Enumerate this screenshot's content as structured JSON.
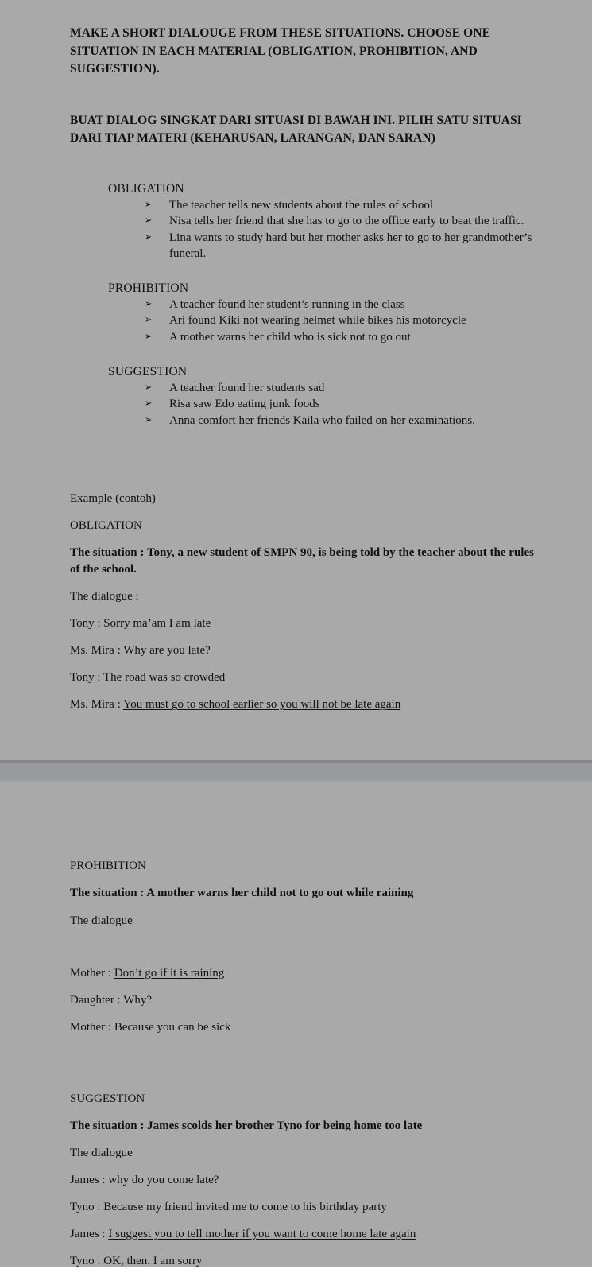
{
  "document": {
    "heading_en": "MAKE A SHORT DIALOUGE FROM THESE SITUATIONS. CHOOSE ONE SITUATION IN EACH MATERIAL (OBLIGATION, PROHIBITION, AND SUGGESTION).",
    "heading_id": "BUAT DIALOG SINGKAT DARI SITUASI DI BAWAH INI. PILIH SATU SITUASI DARI TIAP MATERI (KEHARUSAN, LARANGAN, DAN SARAN)",
    "bullet_glyph": "➢",
    "page_background": "#a9a9a9",
    "gap_color": "#9a9b9d",
    "text_color": "#111111"
  },
  "situations": [
    {
      "title": "OBLIGATION",
      "items": [
        "The teacher tells new students about the rules of school",
        "Nisa tells her friend that she has to go to the office early to beat the traffic.",
        "Lina wants to study hard but her mother asks her to go to her grandmother’s funeral."
      ]
    },
    {
      "title": "PROHIBITION",
      "items": [
        "A teacher found her student’s running in the class",
        "Ari found Kiki not wearing helmet while bikes his motorcycle",
        "A mother warns her child who is sick not to go out"
      ]
    },
    {
      "title": "SUGGESTION",
      "items": [
        "A teacher found her students sad",
        "Risa saw Edo eating junk foods",
        "Anna comfort her friends Kaila who failed on her examinations."
      ]
    }
  ],
  "example": {
    "label": "Example (contoh)",
    "section_title": "OBLIGATION",
    "situation": "The situation : Tony, a new student of SMPN 90,  is being told by the teacher about the rules of the school.",
    "dialogue_label": "The dialogue :",
    "lines": [
      {
        "speaker": "Tony : ",
        "text": "Sorry ma’am I am late",
        "underlined": false
      },
      {
        "speaker": "Ms. Mira : ",
        "text": "Why are you late?",
        "underlined": false
      },
      {
        "speaker": "Tony : ",
        "text": "The road was so crowded",
        "underlined": false
      },
      {
        "speaker": "Ms. Mira : ",
        "text": "You must go to school earlier so you will not be late again",
        "underlined": true
      }
    ]
  },
  "prohibition_example": {
    "section_title": "PROHIBITION",
    "situation": "The situation : A mother warns her child not to go out while raining",
    "dialogue_label": "The dialogue",
    "lines": [
      {
        "speaker": "Mother : ",
        "text": "Don’t go if it is raining",
        "underlined": true
      },
      {
        "speaker": "Daughter : ",
        "text": "Why?",
        "underlined": false
      },
      {
        "speaker": "Mother : ",
        "text": "Because you can be sick",
        "underlined": false
      }
    ]
  },
  "suggestion_example": {
    "section_title": "SUGGESTION",
    "situation": "The situation : James scolds her brother Tyno for being home too late",
    "dialogue_label": "The dialogue",
    "lines": [
      {
        "speaker": "James : ",
        "text": "why do you come late?",
        "underlined": false
      },
      {
        "speaker": "Tyno : ",
        "text": "Because my friend invited me to come to his birthday party",
        "underlined": false
      },
      {
        "speaker": "James : ",
        "text": "I suggest you to tell mother if you want to come home late again",
        "underlined": true
      },
      {
        "speaker": "Tyno : ",
        "text": "OK, then. I am sorry",
        "underlined": false
      }
    ]
  }
}
